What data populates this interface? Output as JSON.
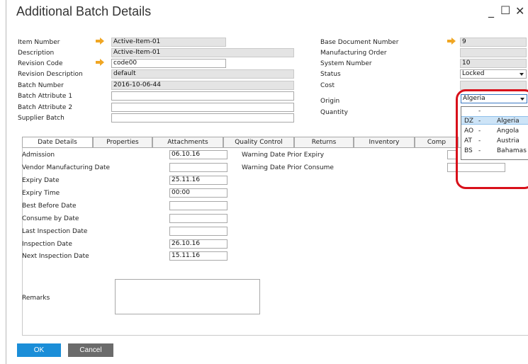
{
  "window": {
    "title": "Additional Batch Details",
    "minimize_icon": "minimize-icon",
    "maximize_icon": "maximize-icon",
    "close_icon": "close-icon"
  },
  "header_left": {
    "item_number": {
      "label": "Item Number",
      "value": "Active-Item-01"
    },
    "description": {
      "label": "Description",
      "value": "Active-Item-01"
    },
    "revision_code": {
      "label": "Revision Code",
      "value": "code00"
    },
    "revision_description": {
      "label": "Revision Description",
      "value": "default"
    },
    "batch_number": {
      "label": "Batch Number",
      "value": "2016-10-06-44"
    },
    "batch_attribute_1": {
      "label": "Batch Attribute 1",
      "value": ""
    },
    "batch_attribute_2": {
      "label": "Batch Attribute 2",
      "value": ""
    },
    "supplier_batch": {
      "label": "Supplier Batch",
      "value": ""
    }
  },
  "header_right": {
    "base_document_number": {
      "label": "Base Document Number",
      "value": "9"
    },
    "manufacturing_order": {
      "label": "Manufacturing Order",
      "value": ""
    },
    "system_number": {
      "label": "System Number",
      "value": "10"
    },
    "status": {
      "label": "Status",
      "value": "Locked"
    },
    "cost": {
      "label": "Cost",
      "value": ""
    },
    "origin": {
      "label": "Origin",
      "value": "Algeria"
    },
    "quantity": {
      "label": "Quantity",
      "value": ""
    }
  },
  "origin_dropdown": {
    "options": [
      {
        "code": "",
        "dash": "-",
        "name": ""
      },
      {
        "code": "DZ",
        "dash": "-",
        "name": "Algeria"
      },
      {
        "code": "AO",
        "dash": "-",
        "name": "Angola"
      },
      {
        "code": "AT",
        "dash": "-",
        "name": "Austria"
      },
      {
        "code": "BS",
        "dash": "-",
        "name": "Bahamas"
      }
    ],
    "selected": "Algeria",
    "highlight_color": "#d8101a"
  },
  "tabs": [
    {
      "label": "Date Details"
    },
    {
      "label": "Properties"
    },
    {
      "label": "Attachments"
    },
    {
      "label": "Quality Control"
    },
    {
      "label": "Returns"
    },
    {
      "label": "Inventory"
    },
    {
      "label": "Comp"
    }
  ],
  "date_details": {
    "admission": {
      "label": "Admission",
      "value": "06.10.16"
    },
    "vendor_manufacturing_date": {
      "label": "Vendor Manufacturing Date",
      "value": ""
    },
    "expiry_date": {
      "label": "Expiry Date",
      "value": "25.11.16"
    },
    "expiry_time": {
      "label": "Expiry Time",
      "value": "00:00"
    },
    "best_before_date": {
      "label": "Best Before Date",
      "value": ""
    },
    "consume_by_date": {
      "label": "Consume by Date",
      "value": ""
    },
    "last_inspection_date": {
      "label": "Last Inspection Date",
      "value": ""
    },
    "inspection_date": {
      "label": "Inspection Date",
      "value": "26.10.16"
    },
    "next_inspection_date": {
      "label": "Next Inspection Date",
      "value": "15.11.16"
    },
    "warning_prior_expiry": {
      "label": "Warning Date Prior Expiry",
      "value": ""
    },
    "warning_prior_consume": {
      "label": "Warning Date Prior Consume",
      "value": ""
    },
    "remarks": {
      "label": "Remarks",
      "value": ""
    }
  },
  "footer": {
    "ok_label": "OK",
    "cancel_label": "Cancel"
  },
  "colors": {
    "ok_button": "#1b8ed8",
    "cancel_button": "#6b6b6b",
    "link_arrow": "#f0a623"
  }
}
